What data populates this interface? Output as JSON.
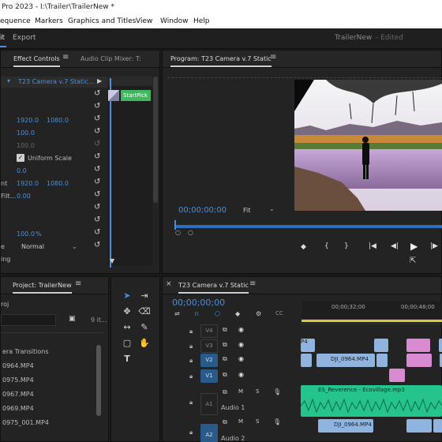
{
  "window": {
    "title": "Pro 2023 - I:\\Trailer\\TrailerNew *"
  },
  "menu": [
    "equence",
    "Markers",
    "Graphics and Titles",
    "View",
    "Window",
    "Help"
  ],
  "workspace": {
    "edit": "it",
    "export": "Export",
    "project_name": "TrailerNew",
    "status": "- Edited"
  },
  "effect_controls": {
    "tab": "Effect Controls",
    "tab2": "Audio Clip Mixer: T:",
    "clip": "T23 Camera v.7 Static...",
    "clip_label": "StartPick",
    "pos_x": "1920.0",
    "pos_y": "1080.0",
    "scale": "100.0",
    "scale_w": "100.0",
    "uniform": "Uniform Scale",
    "rotation": "0.0",
    "anchor_label": "nt",
    "anchor_x": "1920.0",
    "anchor_y": "1080.0",
    "flicker_label": "Filt...",
    "flicker_val": "0.00",
    "opacity_val": "100.0",
    "opacity_unit": "%",
    "blend_label": "e",
    "blend_val": "Normal",
    "bottom_label": "ing"
  },
  "program": {
    "title": "Program: T23 Camera v.7 Static",
    "timecode": "00;00;00;00",
    "fit": "Fit"
  },
  "project": {
    "tab": "Project: TrailerNew",
    "folder": "roj",
    "count": "9 it...",
    "items": [
      "era Transitions",
      "0964.MP4",
      "0975.MP4",
      "0967.MP4",
      "0969.MP4",
      "0975_001.MP4"
    ]
  },
  "timeline": {
    "tab": "T23 Camera v.7 Static",
    "timecode": "00;00;00;00",
    "ruler": [
      "00;00;32;00",
      "00;00;48;00"
    ],
    "tracks": [
      "V4",
      "V3",
      "V2",
      "V1",
      "A1",
      "A2"
    ],
    "audio1_name": "Audio 1",
    "audio2_name": "Audio 2",
    "clip_v2": "DJI_0964.MP4",
    "clip_v4": "P4",
    "clip_a1": "ES_Reverence - Ecovillage.mp3",
    "clip_a2": "DJI_0964.MP4"
  },
  "colors": {
    "accent": "#4a8fdc",
    "audio": "#24c48c",
    "video": "#8fb4e0",
    "pink": "#d88bd0"
  }
}
